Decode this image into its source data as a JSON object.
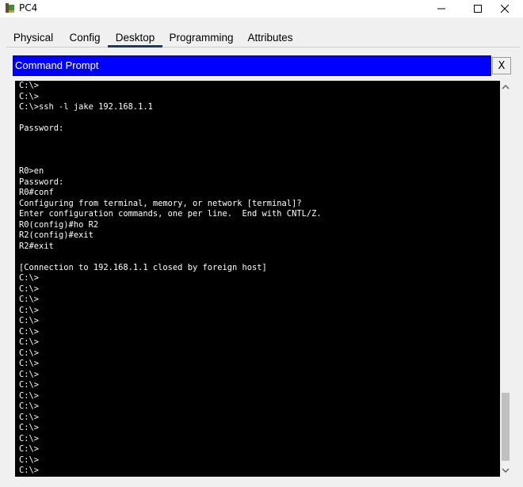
{
  "window": {
    "title": "PC4",
    "icon": "packet-tracer-pc-icon"
  },
  "tabs": [
    {
      "label": "Physical"
    },
    {
      "label": "Config"
    },
    {
      "label": "Desktop",
      "active": true
    },
    {
      "label": "Programming"
    },
    {
      "label": "Attributes"
    }
  ],
  "command_prompt": {
    "title": "Command Prompt",
    "close_label": "X"
  },
  "terminal": {
    "lines": [
      "C:\\>",
      "C:\\>",
      "C:\\>ssh -l jake 192.168.1.1",
      "",
      "Password:",
      "",
      "",
      "",
      "R0>en",
      "Password:",
      "R0#conf",
      "Configuring from terminal, memory, or network [terminal]?",
      "Enter configuration commands, one per line.  End with CNTL/Z.",
      "R0(config)#ho R2",
      "R2(config)#exit",
      "R2#exit",
      "",
      "[Connection to 192.168.1.1 closed by foreign host]",
      "C:\\>",
      "C:\\>",
      "C:\\>",
      "C:\\>",
      "C:\\>",
      "C:\\>",
      "C:\\>",
      "C:\\>",
      "C:\\>",
      "C:\\>",
      "C:\\>",
      "C:\\>",
      "C:\\>",
      "C:\\>",
      "C:\\>",
      "C:\\>",
      "C:\\>",
      "C:\\>",
      "C:\\>",
      "C:\\>"
    ]
  },
  "colors": {
    "header_blue": "#0000ff",
    "terminal_bg": "#000000",
    "terminal_fg": "#ffffff"
  }
}
